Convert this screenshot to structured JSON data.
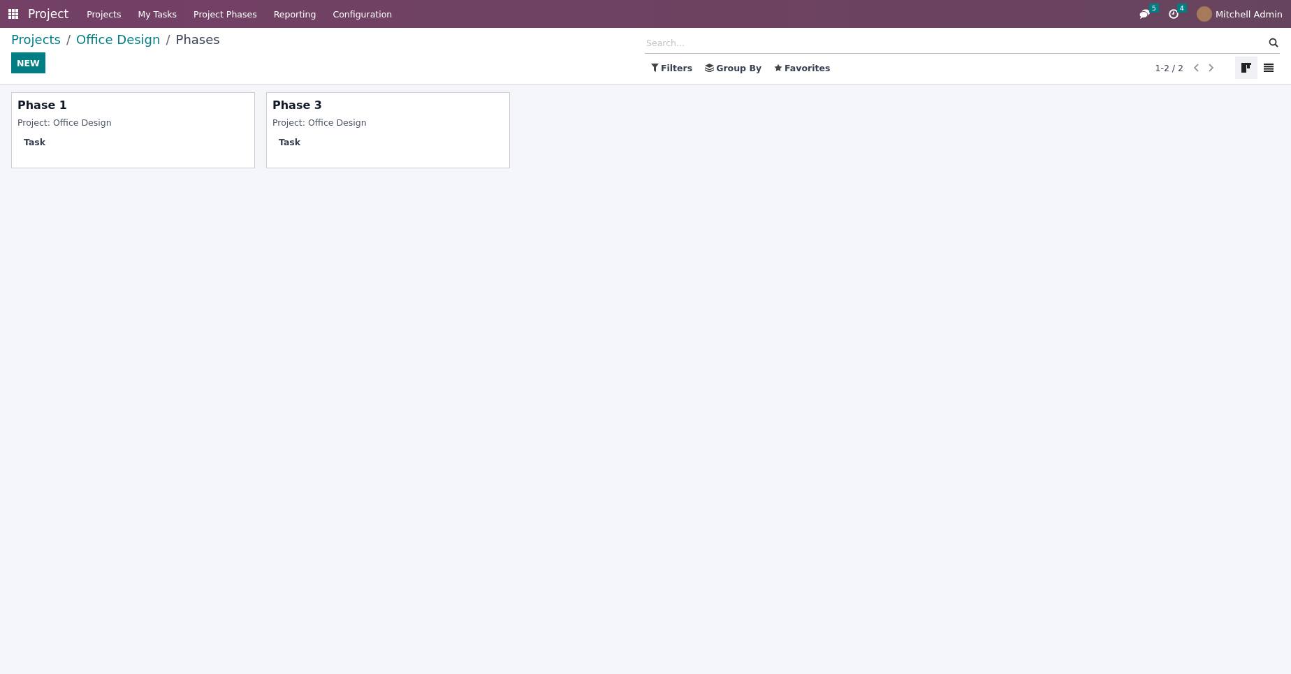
{
  "navbar": {
    "app_name": "Project",
    "menu": [
      "Projects",
      "My Tasks",
      "Project Phases",
      "Reporting",
      "Configuration"
    ],
    "messages_count": "5",
    "activities_count": "4",
    "user": "Mitchell Admin"
  },
  "breadcrumbs": [
    "Projects",
    "Office Design",
    "Phases"
  ],
  "breadcrumb_separators": [
    "/",
    "/"
  ],
  "new_button": "NEW",
  "search": {
    "placeholder": "Search..."
  },
  "filters": [
    "Filters",
    "Group By",
    "Favorites"
  ],
  "pager": "1-2 / 2",
  "views": [
    {
      "kind": "kanban",
      "selected": true
    },
    {
      "kind": "list",
      "selected": false
    }
  ],
  "cards": [
    {
      "title": "Phase 1",
      "project": "Project: Office Design",
      "button": "Task"
    },
    {
      "title": "Phase 3",
      "project": "Project: Office Design",
      "button": "Task"
    }
  ]
}
